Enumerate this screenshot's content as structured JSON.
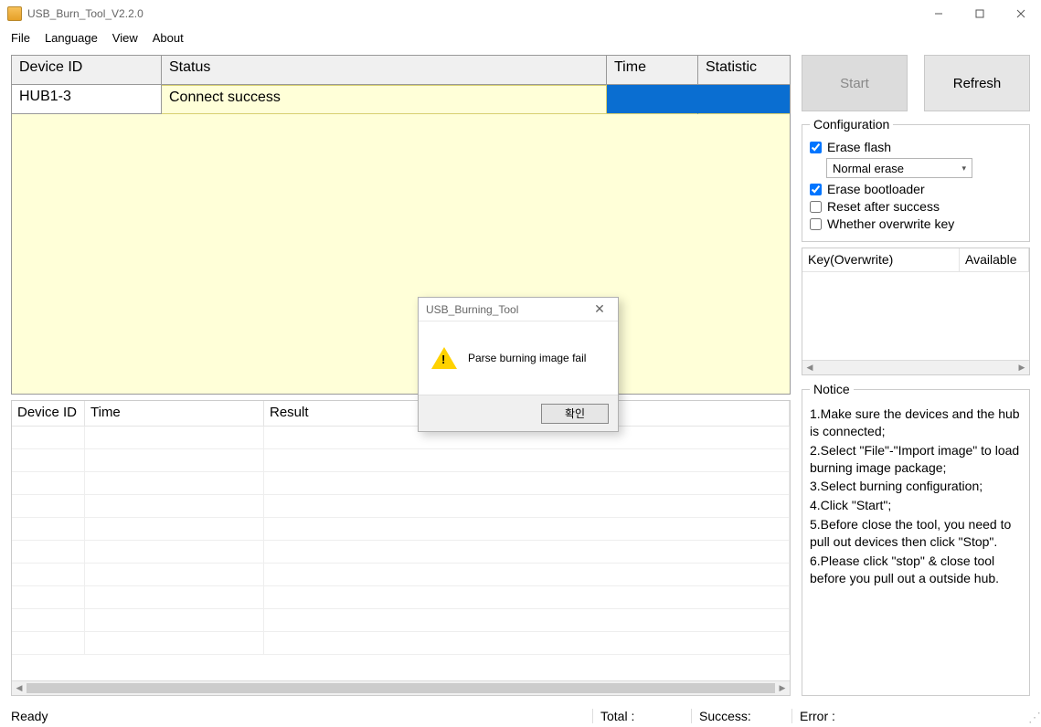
{
  "window": {
    "title": "USB_Burn_Tool_V2.2.0"
  },
  "menu": {
    "file": "File",
    "language": "Language",
    "view": "View",
    "about": "About"
  },
  "topTable": {
    "headers": {
      "device": "Device ID",
      "status": "Status",
      "time": "Time",
      "statistic": "Statistic"
    },
    "row": {
      "device": "HUB1-3",
      "status": "Connect success",
      "time": "",
      "statistic": ""
    }
  },
  "resultTable": {
    "headers": {
      "device": "Device ID",
      "time": "Time",
      "result": "Result"
    }
  },
  "buttons": {
    "start": "Start",
    "refresh": "Refresh"
  },
  "config": {
    "legend": "Configuration",
    "eraseFlash": {
      "label": "Erase flash",
      "checked": true
    },
    "eraseMode": "Normal erase",
    "eraseBootloader": {
      "label": "Erase bootloader",
      "checked": true
    },
    "resetAfter": {
      "label": "Reset after success",
      "checked": false
    },
    "overwriteKey": {
      "label": "Whether overwrite key",
      "checked": false
    }
  },
  "keyTable": {
    "header1": "Key(Overwrite)",
    "header2": "Available"
  },
  "notice": {
    "legend": "Notice",
    "l1": "1.Make sure the devices and the hub is connected;",
    "l2": "2.Select \"File\"-\"Import image\" to load burning image package;",
    "l3": "3.Select burning configuration;",
    "l4": "4.Click \"Start\";",
    "l5": "5.Before close the tool, you need to pull out devices then click \"Stop\".",
    "l6": "6.Please click \"stop\" & close tool before you pull out a outside hub."
  },
  "status": {
    "ready": "Ready",
    "total": "Total :",
    "success": "Success:",
    "error": "Error :"
  },
  "dialog": {
    "title": "USB_Burning_Tool",
    "message": "Parse burning image fail",
    "ok": "확인"
  }
}
